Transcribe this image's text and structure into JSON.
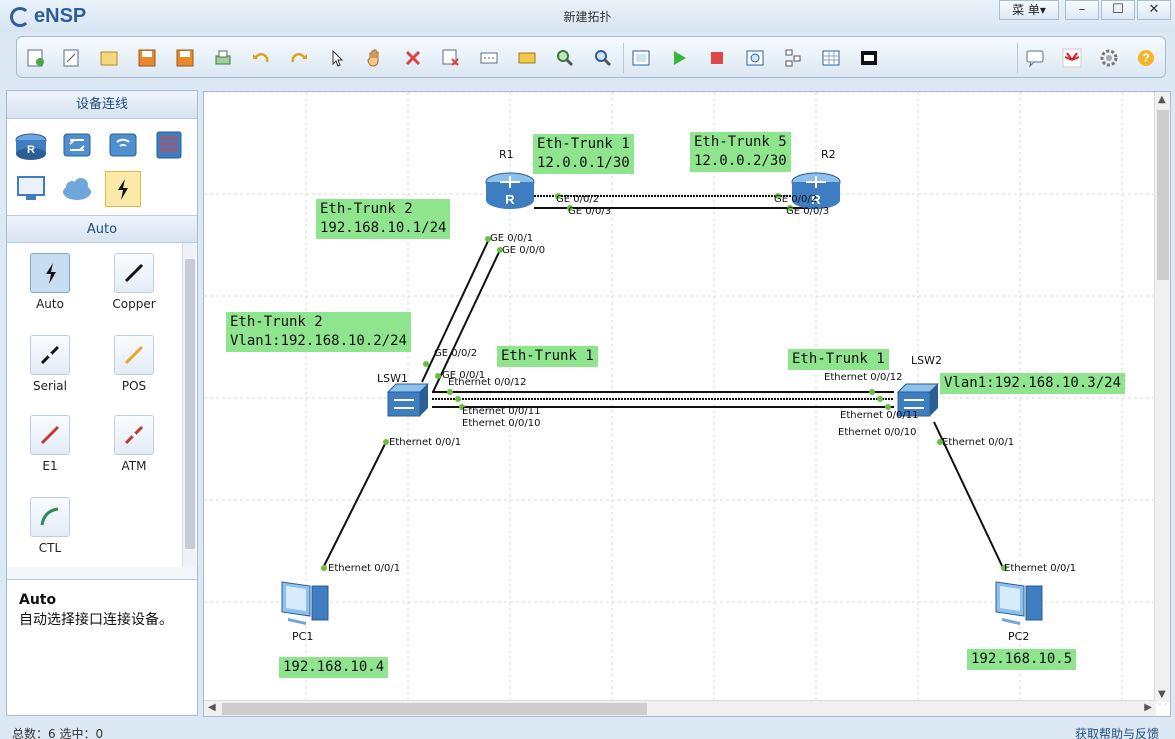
{
  "app": {
    "name": "eNSP",
    "window_title": "新建拓扑",
    "menu_label": "菜 单▾"
  },
  "window_controls": {
    "minimize": "–",
    "maximize": "☐",
    "close": "✕"
  },
  "toolbar": {
    "icons": [
      "new-topology",
      "new-example",
      "open",
      "save",
      "save-as",
      "print",
      "undo",
      "redo",
      "select",
      "pan",
      "delete",
      "delete-link",
      "text",
      "palette",
      "zoom-in",
      "zoom-out",
      "fit",
      "start",
      "stop",
      "capture",
      "topology",
      "grid",
      "screen"
    ],
    "right_icons": [
      "chat",
      "huawei",
      "settings",
      "help"
    ]
  },
  "left_panel": {
    "title": "设备连线",
    "categories": [
      "router",
      "switch",
      "wireless",
      "firewall",
      "pc",
      "cloud",
      "link"
    ],
    "sub_title": "Auto",
    "cables": [
      {
        "label": "Auto",
        "color": "#1a1a1a"
      },
      {
        "label": "Copper",
        "color": "#111111"
      },
      {
        "label": "Serial",
        "color": "#111111"
      },
      {
        "label": "POS",
        "color": "#f0a030"
      },
      {
        "label": "E1",
        "color": "#c0392b"
      },
      {
        "label": "ATM",
        "color": "#c0392b"
      },
      {
        "label": "CTL",
        "color": "#2e8b57"
      }
    ],
    "desc_title": "Auto",
    "desc_text": "自动选择接口连接设备。"
  },
  "topology": {
    "devices": [
      {
        "name": "R1"
      },
      {
        "name": "R2"
      },
      {
        "name": "LSW1"
      },
      {
        "name": "LSW2"
      },
      {
        "name": "PC1"
      },
      {
        "name": "PC2"
      }
    ],
    "labels": {
      "r1_trunk": "Eth-Trunk 1\n12.0.0.1/30",
      "r2_trunk": "Eth-Trunk 5\n12.0.0.2/30",
      "r1_trunk2": "Eth-Trunk 2\n192.168.10.1/24",
      "lsw1_trunk2": "Eth-Trunk 2\nVlan1:192.168.10.2/24",
      "lsw1_trunk1": "Eth-Trunk 1",
      "lsw2_trunk1": "Eth-Trunk 1",
      "lsw2_vlan": "Vlan1:192.168.10.3/24",
      "pc1_ip": "192.168.10.4",
      "pc2_ip": "192.168.10.5"
    },
    "ports": {
      "r1_ge002": "GE 0/0/2",
      "r1_ge003": "GE 0/0/3",
      "r2_ge002": "GE 0/0/2",
      "r2_ge003": "GE 0/0/3",
      "r1_ge001": "GE 0/0/1",
      "r1_ge000": "GE 0/0/0",
      "lsw1_ge002": "GE 0/0/2",
      "lsw1_ge001": "GE 0/0/1",
      "lsw1_e0012": "Ethernet 0/0/12",
      "lsw1_e0011": "Ethernet 0/0/11",
      "lsw1_e0010": "Ethernet 0/0/10",
      "lsw1_e001": "Ethernet 0/0/1",
      "lsw2_e0012": "Ethernet 0/0/12",
      "lsw2_e0011": "Ethernet 0/0/11",
      "lsw2_e0010": "Ethernet 0/0/10",
      "lsw2_e001": "Ethernet 0/0/1",
      "pc1_e001": "Ethernet 0/0/1",
      "pc2_e001": "Ethernet 0/0/1"
    }
  },
  "status": {
    "left": "总数：6  选中：0",
    "right": "获取帮助与反馈"
  }
}
